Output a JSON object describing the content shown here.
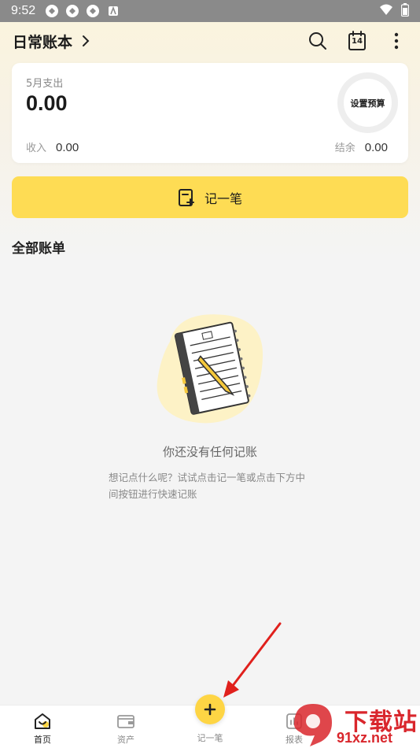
{
  "status_bar": {
    "time": "9:52"
  },
  "header": {
    "book_name": "日常账本"
  },
  "calendar": {
    "day": "14"
  },
  "summary": {
    "month_label": "5月支出",
    "month_expense": "0.00",
    "budget_label": "设置预算",
    "income_label": "收入",
    "income_value": "0.00",
    "balance_label": "结余",
    "balance_value": "0.00"
  },
  "record_button": {
    "label": "记一笔"
  },
  "bills": {
    "section_title": "全部账单",
    "empty_title": "你还没有任何记账",
    "empty_hint": "想记点什么呢？试试点击记一笔或点击下方中间按钮进行快速记账"
  },
  "bottom_nav": {
    "items": [
      {
        "label": "首页"
      },
      {
        "label": "资产"
      },
      {
        "label": "记一笔"
      },
      {
        "label": "报表"
      }
    ]
  },
  "watermark": {
    "brand": "下载站",
    "site": "91xz.net"
  },
  "colors": {
    "accent": "#fedc54",
    "fab": "#fed544",
    "arrow": "#e0201c"
  }
}
